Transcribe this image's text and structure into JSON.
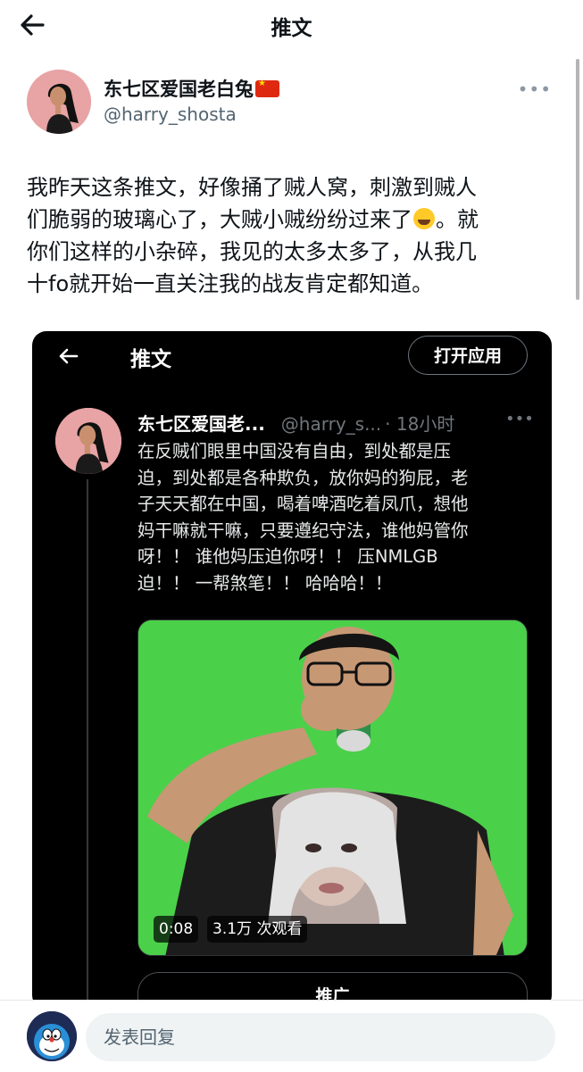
{
  "header": {
    "title": "推文",
    "back_icon": "arrow-left-icon"
  },
  "tweet": {
    "author": {
      "name": "东七区爱国老白兔",
      "flag_icon": "china-flag-icon",
      "handle": "@harry_shosta"
    },
    "more_icon": "more-horizontal-icon",
    "text_part1": "我昨天这条推文，好像捅了贼人窝，刺激到贼人\n们脆弱的玻璃心了，大贼小贼纷纷过来了",
    "emoji": "joy-emoji",
    "text_part2": "。就\n你们这样的小杂碎，我见的太多太多了，从我几\n十fo就开始一直关注我的战友肯定都知道。"
  },
  "embedded_screenshot": {
    "header_title": "推文",
    "open_app_label": "打开应用",
    "quoted": {
      "name": "东七区爱国老...",
      "handle": "@harry_s...",
      "time": "· 18小时",
      "text": "在反贼们眼里中国没有自由，到处都是压\n迫，到处都是各种欺负，放你妈的狗屁，老\n子天天都在中国，喝着啤酒吃着凤爪，想他\n妈干嘛就干嘛，只要遵纪守法，谁他妈管你\n呀！！ 谁他妈压迫你呀！！ 压NMLGB\n迫！！ 一帮煞笔！！ 哈哈哈！！",
      "video": {
        "duration": "0:08",
        "views": "3.1万 次观看"
      },
      "promote_label": "推广"
    }
  },
  "reply": {
    "placeholder": "发表回复",
    "avatar_icon": "doraemon-avatar-icon"
  },
  "colors": {
    "accent_text": "#0f1419",
    "secondary_text": "#536471",
    "dark_bg": "#000000",
    "video_green": "#4bd04a",
    "flag_red": "#de2910"
  }
}
